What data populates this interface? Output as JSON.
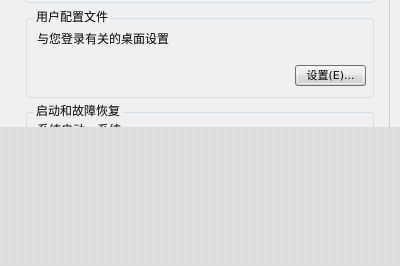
{
  "profile_group": {
    "title": "用户配置文件",
    "description": "与您登录有关的桌面设置",
    "settings_button": "设置(E)..."
  },
  "startup_group": {
    "title": "启动和故障恢复",
    "description_partial": "系统启动、系统"
  }
}
